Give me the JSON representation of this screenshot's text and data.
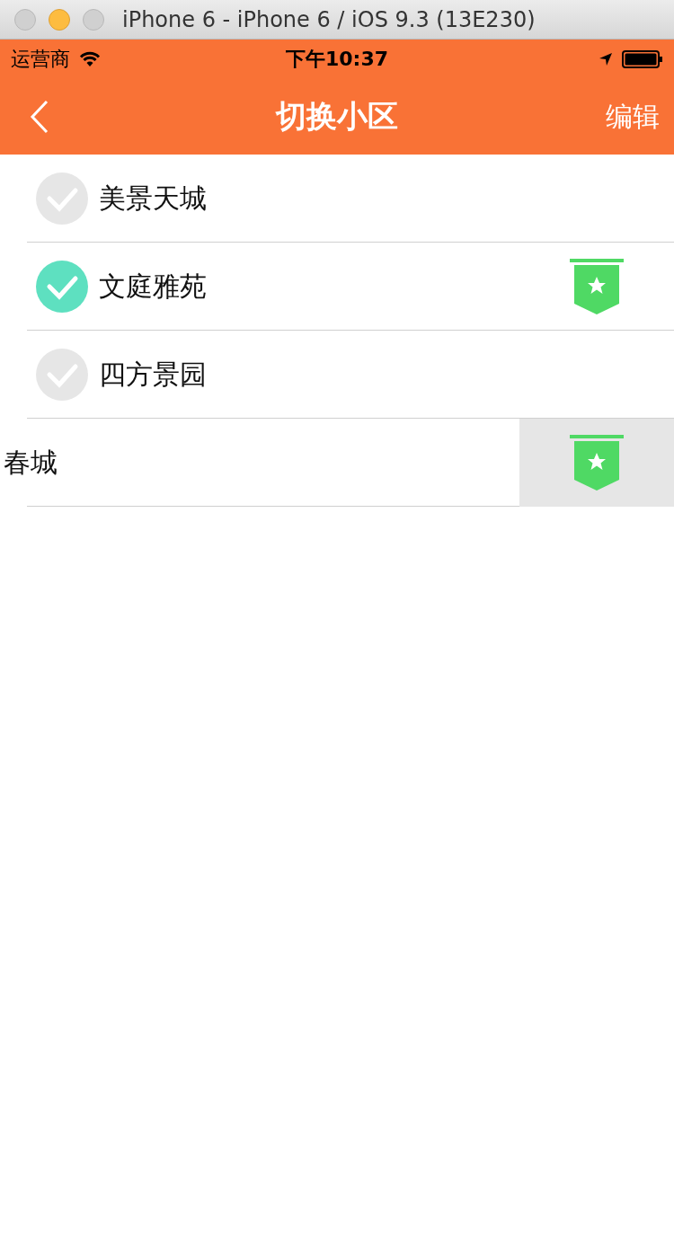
{
  "window": {
    "title": "iPhone 6 - iPhone 6 / iOS 9.3 (13E230)"
  },
  "status_bar": {
    "carrier": "运营商",
    "time": "下午10:37"
  },
  "nav_bar": {
    "title": "切换小区",
    "action": "编辑"
  },
  "communities": [
    {
      "name": "美景天城",
      "selected": false,
      "default": false,
      "swiped": false
    },
    {
      "name": "文庭雅苑",
      "selected": true,
      "default": true,
      "swiped": false
    },
    {
      "name": "四方景园",
      "selected": false,
      "default": false,
      "swiped": false
    },
    {
      "name": "春城",
      "default": true,
      "swiped": true
    }
  ]
}
